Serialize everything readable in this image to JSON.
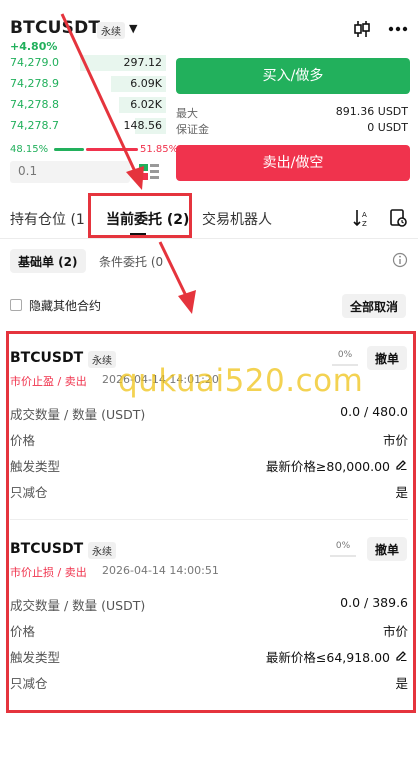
{
  "header": {
    "symbol": "BTCUSDT",
    "contract_type": "永续",
    "change": "+4.80%",
    "icons": [
      "candlestick-icon",
      "more-icon"
    ]
  },
  "order_book": {
    "rows": [
      {
        "price": "74,279.0",
        "qty": "297.12",
        "depth": 0.55
      },
      {
        "price": "74,278.9",
        "qty": "6.09K",
        "depth": 0.35
      },
      {
        "price": "74,278.8",
        "qty": "6.02K",
        "depth": 0.3
      },
      {
        "price": "74,278.7",
        "qty": "148.56",
        "depth": 0.2
      }
    ],
    "buy_pct": "48.15%",
    "sell_pct": "51.85%",
    "depth_value": "0.1"
  },
  "trade_panel": {
    "buy_label": "买入/做多",
    "max_label": "最大",
    "max_value": "891.36 USDT",
    "margin_label": "保证金",
    "margin_value": "0 USDT",
    "sell_label": "卖出/做空"
  },
  "tabs": {
    "positions": "持有仓位 (1",
    "open_orders": "当前委托 (2)",
    "bots": "交易机器人"
  },
  "subtabs": {
    "basic": "基础单 (2)",
    "conditional": "条件委托 (0"
  },
  "filters": {
    "hide_other": "隐藏其他合约",
    "cancel_all": "全部取消"
  },
  "orders": [
    {
      "symbol": "BTCUSDT",
      "contract_type": "永续",
      "type": "市价止盈 / 卖出",
      "time": "2026-04-14 14:01:20",
      "progress": "0%",
      "cancel": "撤单",
      "fill_label": "成交数量 / 数量 (USDT)",
      "fill_value": "0.0 / 480.0",
      "price_label": "价格",
      "price_value": "市价",
      "trigger_label": "触发类型",
      "trigger_value": "最新价格≥80,000.00",
      "reduce_label": "只减仓",
      "reduce_value": "是"
    },
    {
      "symbol": "BTCUSDT",
      "contract_type": "永续",
      "type": "市价止损 / 卖出",
      "time": "2026-04-14 14:00:51",
      "progress": "0%",
      "cancel": "撤单",
      "fill_label": "成交数量 / 数量 (USDT)",
      "fill_value": "0.0 / 389.6",
      "price_label": "价格",
      "price_value": "市价",
      "trigger_label": "触发类型",
      "trigger_value": "最新价格≤64,918.00",
      "reduce_label": "只减仓",
      "reduce_value": "是"
    }
  ],
  "watermark": "qukuai520.com",
  "colors": {
    "buy": "#22b05c",
    "sell": "#f0334d",
    "highlight": "#e5343d",
    "watermark": "#f0c419"
  }
}
